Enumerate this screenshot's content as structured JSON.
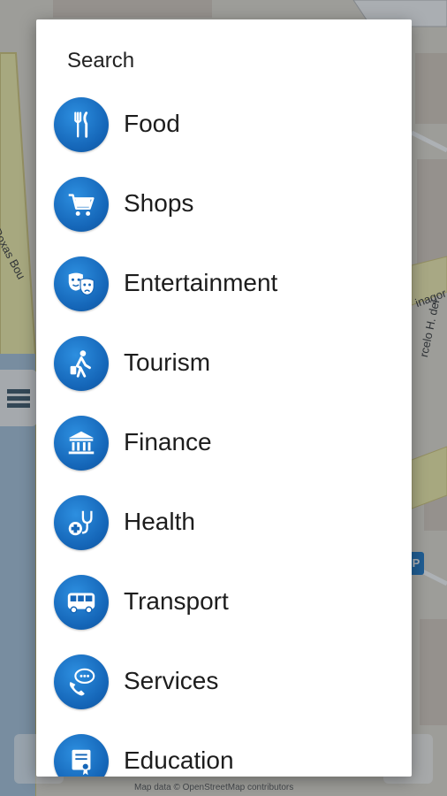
{
  "map": {
    "labels": {
      "roxas": "Roxas Bou",
      "rd": "rcelo H. del",
      "agor": "inagor"
    },
    "attribution": "Map data © OpenStreetMap contributors"
  },
  "dialog": {
    "title": "Search",
    "categories": [
      {
        "label": "Food",
        "icon": "fork-knife-icon"
      },
      {
        "label": "Shops",
        "icon": "shopping-cart-icon"
      },
      {
        "label": "Entertainment",
        "icon": "theater-masks-icon"
      },
      {
        "label": "Tourism",
        "icon": "traveler-icon"
      },
      {
        "label": "Finance",
        "icon": "bank-icon"
      },
      {
        "label": "Health",
        "icon": "stethoscope-icon"
      },
      {
        "label": "Transport",
        "icon": "bus-icon"
      },
      {
        "label": "Services",
        "icon": "phone-chat-icon"
      },
      {
        "label": "Education",
        "icon": "diploma-icon"
      }
    ]
  },
  "colors": {
    "accent": "#1566b8",
    "dialog_bg": "#ffffff",
    "text": "#1d1d1d"
  }
}
